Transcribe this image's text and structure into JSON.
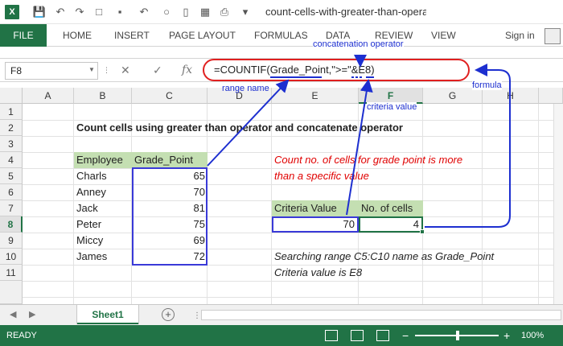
{
  "window": {
    "title": "count-cells-with-greater-than-operat..."
  },
  "ribbon": {
    "file": "FILE",
    "tabs": [
      "HOME",
      "INSERT",
      "PAGE LAYOUT",
      "FORMULAS",
      "DATA",
      "REVIEW",
      "VIEW"
    ],
    "sign_in": "Sign in"
  },
  "formula_bar": {
    "name_box": "F8",
    "fx": "fx",
    "formula": "=COUNTIF(Grade_Point,\">=\"&E8)"
  },
  "columns": [
    "A",
    "B",
    "C",
    "D",
    "E",
    "F",
    "G",
    "H"
  ],
  "rows": [
    "1",
    "2",
    "3",
    "4",
    "5",
    "6",
    "7",
    "8",
    "9",
    "10",
    "11"
  ],
  "sheet": {
    "title": "Count cells using greater than operator and concatenate operator",
    "table_headers": [
      "Employee",
      "Grade_Point"
    ],
    "employees": [
      {
        "name": "Charls",
        "grade": "65"
      },
      {
        "name": "Anney",
        "grade": "70"
      },
      {
        "name": "Jack",
        "grade": "81"
      },
      {
        "name": "Peter",
        "grade": "75"
      },
      {
        "name": "Miccy",
        "grade": "69"
      },
      {
        "name": "James",
        "grade": "72"
      }
    ],
    "note_line1": "Count no. of cells for grade point is more",
    "note_line2": "than a specific value",
    "criteria_header": "Criteria Value",
    "count_header": "No. of cells",
    "criteria_value": "70",
    "count_value": "4",
    "info_line1": "Searching range C5:C10 name as Grade_Point",
    "info_line2": "Criteria value is E8"
  },
  "annotations": {
    "concat": "concatenation operator",
    "range": "range name",
    "criteria": "criteria value",
    "formula": "formula"
  },
  "sheet_tabs": {
    "active": "Sheet1",
    "add": "+"
  },
  "status": {
    "ready": "READY",
    "zoom": "100%",
    "minus": "−",
    "plus": "+"
  },
  "colors": {
    "excel_green": "#217346",
    "annotation_blue": "#1d2fd0",
    "note_red": "#e00000",
    "header_fill": "#c4dfb2"
  }
}
